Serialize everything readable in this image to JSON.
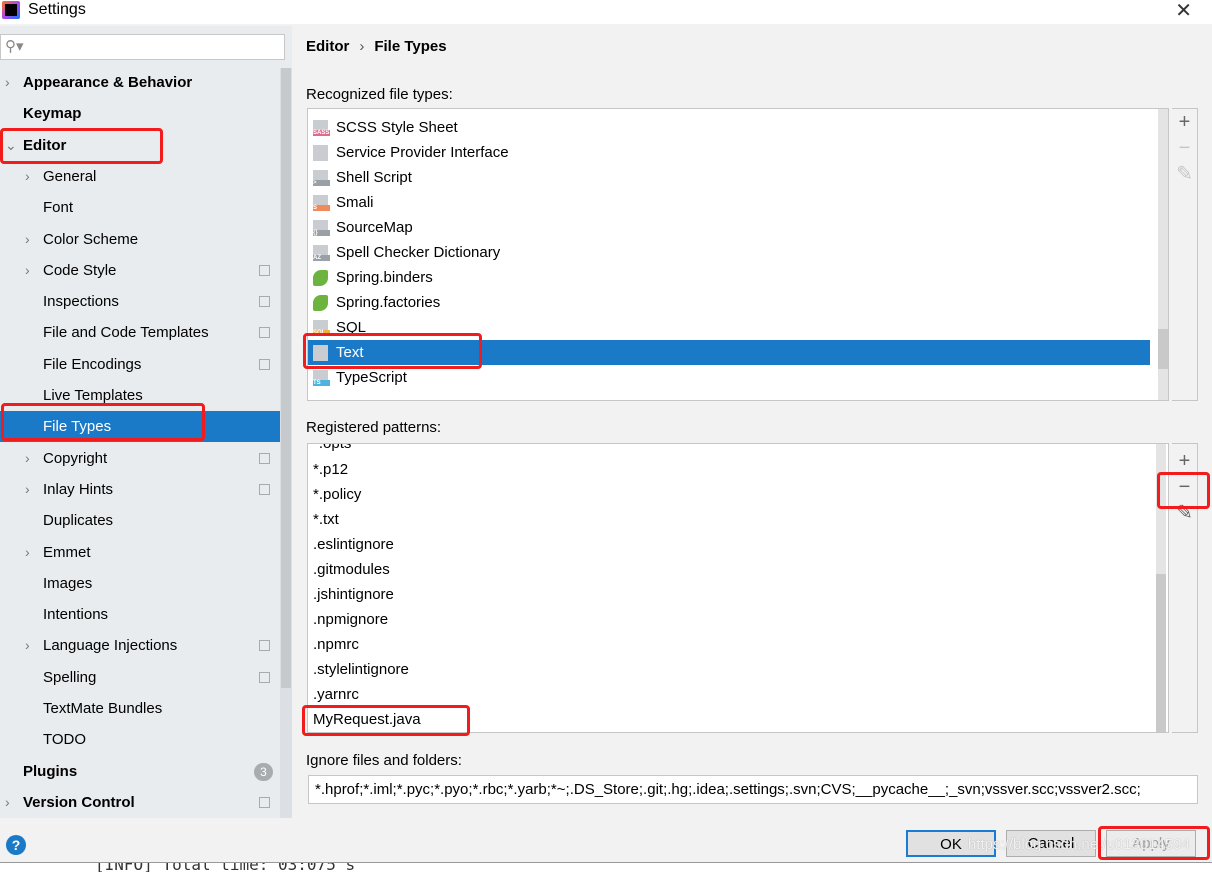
{
  "window": {
    "title": "Settings",
    "close": "✕"
  },
  "search": {
    "placeholder": "",
    "icon": "search-icon",
    "glyph": "⚲▾"
  },
  "sidebar": {
    "items": [
      {
        "label": "Appearance & Behavior",
        "level": 0,
        "arrow": "›",
        "bold": true
      },
      {
        "label": "Keymap",
        "level": 0,
        "bold": true
      },
      {
        "label": "Editor",
        "level": 0,
        "arrow": "⌄",
        "bold": true
      },
      {
        "label": "General",
        "level": 1,
        "arrow": "›"
      },
      {
        "label": "Font",
        "level": 1
      },
      {
        "label": "Color Scheme",
        "level": 1,
        "arrow": "›"
      },
      {
        "label": "Code Style",
        "level": 1,
        "arrow": "›",
        "copy": true
      },
      {
        "label": "Inspections",
        "level": 1,
        "copy": true
      },
      {
        "label": "File and Code Templates",
        "level": 1,
        "copy": true
      },
      {
        "label": "File Encodings",
        "level": 1,
        "copy": true
      },
      {
        "label": "Live Templates",
        "level": 1
      },
      {
        "label": "File Types",
        "level": 1,
        "selected": true
      },
      {
        "label": "Copyright",
        "level": 1,
        "arrow": "›",
        "copy": true
      },
      {
        "label": "Inlay Hints",
        "level": 1,
        "arrow": "›",
        "copy": true
      },
      {
        "label": "Duplicates",
        "level": 1
      },
      {
        "label": "Emmet",
        "level": 1,
        "arrow": "›"
      },
      {
        "label": "Images",
        "level": 1
      },
      {
        "label": "Intentions",
        "level": 1
      },
      {
        "label": "Language Injections",
        "level": 1,
        "arrow": "›",
        "copy": true
      },
      {
        "label": "Spelling",
        "level": 1,
        "copy": true
      },
      {
        "label": "TextMate Bundles",
        "level": 1
      },
      {
        "label": "TODO",
        "level": 1
      },
      {
        "label": "Plugins",
        "level": 0,
        "bold": true,
        "badge": "3"
      },
      {
        "label": "Version Control",
        "level": 0,
        "arrow": "›",
        "bold": true,
        "copy": true
      }
    ]
  },
  "breadcrumb": {
    "parent": "Editor",
    "sep": "›",
    "current": "File Types"
  },
  "recognized": {
    "label": "Recognized file types:",
    "items": [
      {
        "label": "SCSS Style Sheet",
        "badge": "SASS",
        "color": "#e06c8c"
      },
      {
        "label": "Service Provider Interface"
      },
      {
        "label": "Shell Script",
        "badge": ">",
        "color": "#9aa0a6"
      },
      {
        "label": "Smali",
        "badge": "S",
        "color": "#f08a5d"
      },
      {
        "label": "SourceMap",
        "badge": "{}",
        "color": "#9aa0a6"
      },
      {
        "label": "Spell Checker Dictionary",
        "badge": "AZ",
        "color": "#9aa0a6"
      },
      {
        "label": "Spring.binders",
        "color": "#6db33f"
      },
      {
        "label": "Spring.factories",
        "color": "#6db33f"
      },
      {
        "label": "SQL",
        "badge": "SQL",
        "color": "#f0b040"
      },
      {
        "label": "Text",
        "selected": true
      },
      {
        "label": "TypeScript",
        "badge": "TS",
        "color": "#4fb3e0"
      }
    ]
  },
  "patterns": {
    "label": "Registered patterns:",
    "items": [
      "*.p12",
      "*.policy",
      "*.txt",
      ".eslintignore",
      ".gitmodules",
      ".jshintignore",
      ".npmignore",
      ".npmrc",
      ".stylelintignore",
      ".yarnrc",
      "MyRequest.java"
    ]
  },
  "toolbar": {
    "add": "+",
    "remove": "−",
    "edit": "✎"
  },
  "ignore": {
    "label": "Ignore files and folders:",
    "value": "*.hprof;*.iml;*.pyc;*.pyo;*.rbc;*.yarb;*~;.DS_Store;.git;.hg;.idea;.settings;.svn;CVS;__pycache__;_svn;vssver.scc;vssver2.scc;"
  },
  "buttons": {
    "help": "?",
    "ok": "OK",
    "cancel": "Cancel",
    "apply": "Apply"
  },
  "terminal": {
    "text": "[INFO] Total time:  03:075 s"
  },
  "watermark": "https://blog.csdn.net/u013014594",
  "colors": {
    "selection": "#1b7ac7",
    "highlight": "#f21c1c"
  }
}
